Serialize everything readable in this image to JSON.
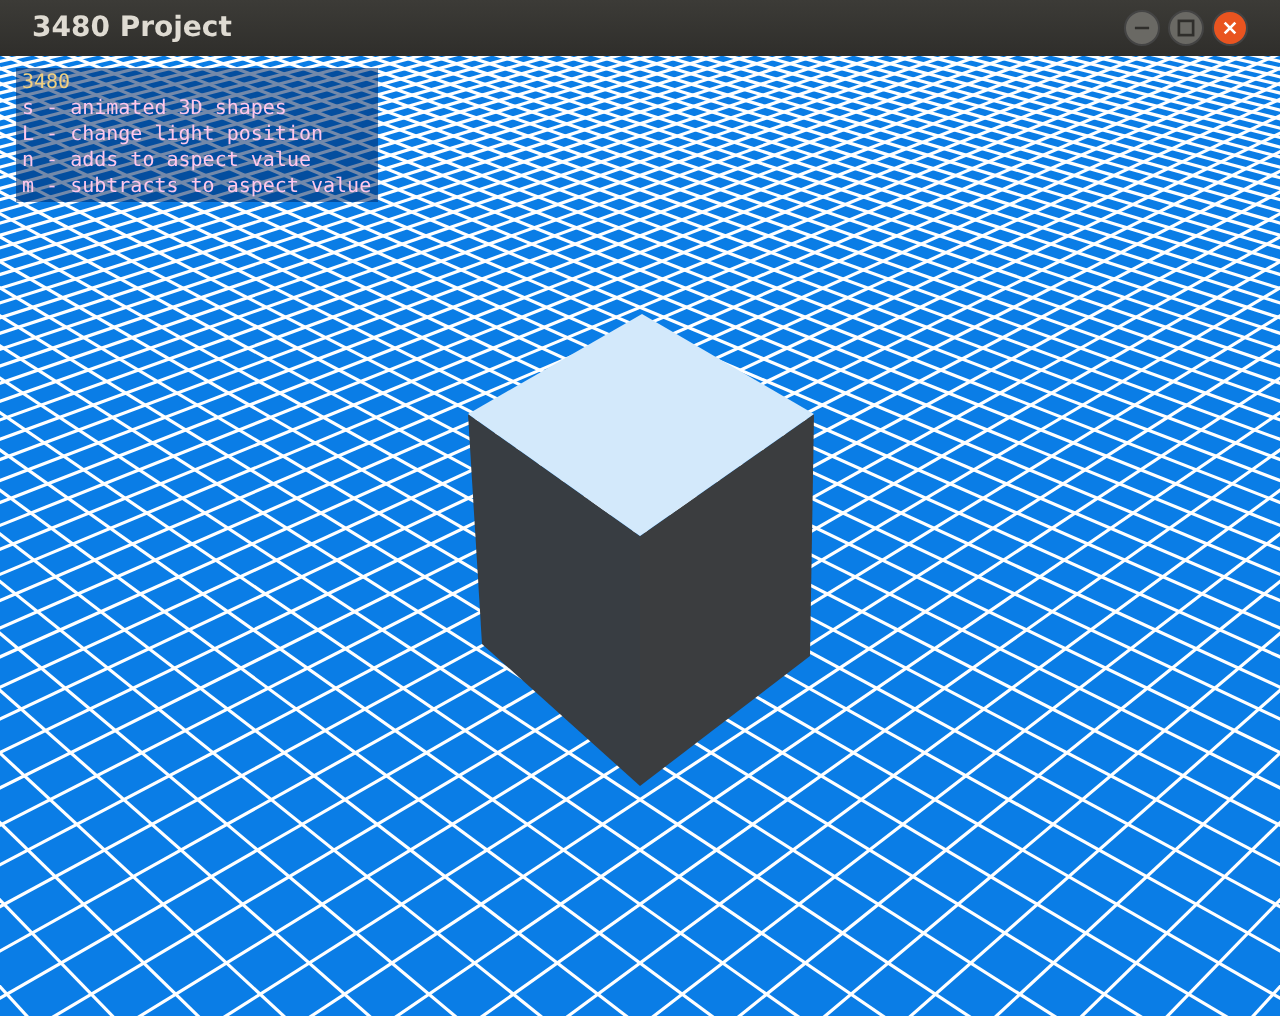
{
  "window": {
    "title": "3480 Project"
  },
  "overlay": {
    "heading": "3480",
    "lines": [
      "s - animated 3D shapes",
      "L - change light position",
      "n - adds to aspect value",
      "m - subtracts to aspect value"
    ]
  }
}
